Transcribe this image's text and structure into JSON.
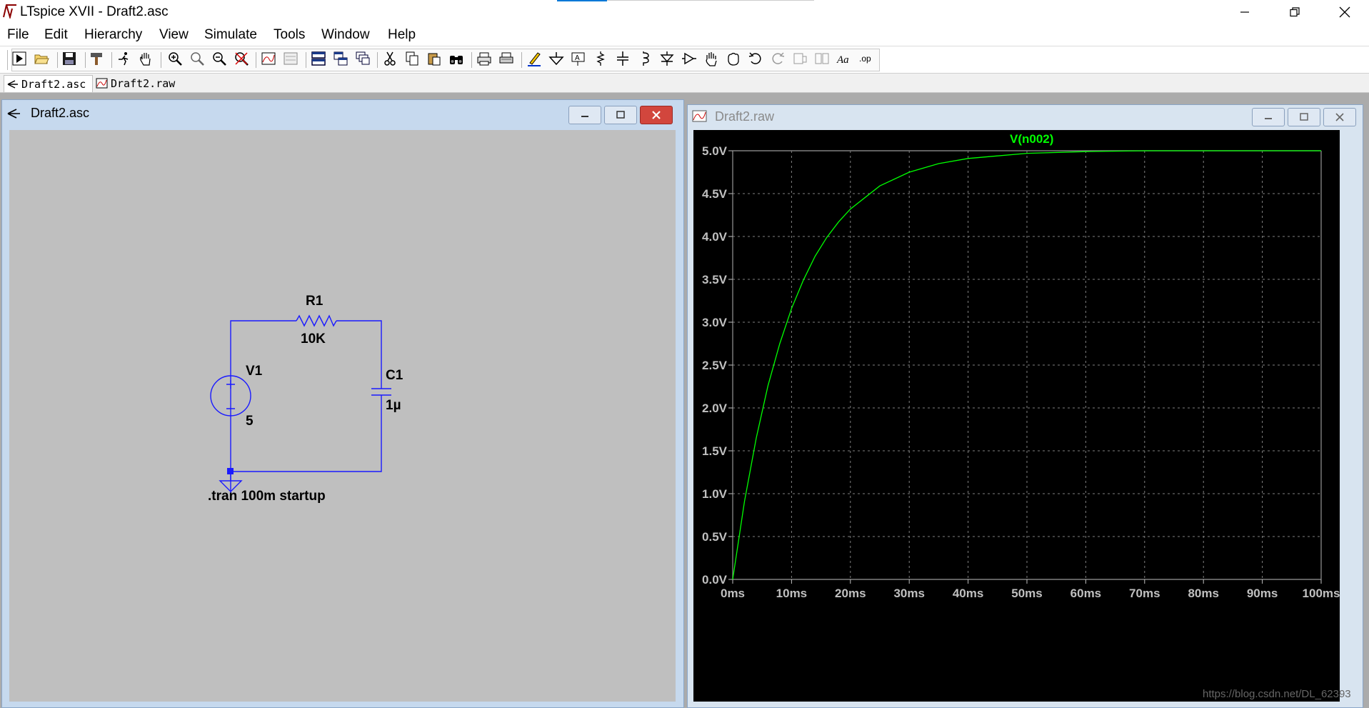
{
  "app": {
    "title": "LTspice XVII - Draft2.asc",
    "icon": "ltspice-logo-icon"
  },
  "window_controls": [
    "minimize-icon",
    "restore-icon",
    "close-icon"
  ],
  "menu": [
    "File",
    "Edit",
    "Hierarchy",
    "View",
    "Simulate",
    "Tools",
    "Window",
    "Help"
  ],
  "toolbar": {
    "buttons": [
      "run",
      "open",
      "save",
      "control-panel",
      "halt",
      "pan",
      "zoom-in",
      "zoom-area",
      "zoom-out",
      "zoom-fit",
      "autorange",
      "mark-unref",
      "tile-horizontal",
      "tile-vertical",
      "cascade",
      "cut",
      "copy",
      "paste",
      "find",
      "print-setup",
      "print",
      "draw-wire",
      "ground",
      "label-net",
      "resistor",
      "capacitor",
      "inductor",
      "diode",
      "component",
      "move",
      "drag",
      "undo",
      "redo",
      "rotate",
      "mirror",
      "text",
      "spice-directive"
    ]
  },
  "tabs": [
    {
      "label": "Draft2.asc",
      "icon": "schematic-icon",
      "active": true
    },
    {
      "label": "Draft2.raw",
      "icon": "waveform-icon",
      "active": false
    }
  ],
  "schematic_window": {
    "title": "Draft2.asc",
    "components": {
      "resistor": {
        "name": "R1",
        "value": "10K"
      },
      "source": {
        "name": "V1",
        "value": "5"
      },
      "capacitor": {
        "name": "C1",
        "value": "1µ"
      }
    },
    "directive": ".tran 100m startup"
  },
  "waveform_window": {
    "title": "Draft2.raw",
    "trace_label": "V(n002)",
    "watermark": "https://blog.csdn.net/DL_62393"
  },
  "colors": {
    "schematic_bg": "#bfbfbf",
    "wire": "#1a1aff",
    "plot_bg": "#000000",
    "trace": "#00ff00",
    "grid": "#808080",
    "axis_text": "#c0c0c0",
    "window_frame": "#c6d9ee",
    "close_button": "#d2463d"
  },
  "chart_data": {
    "type": "line",
    "title": "V(n002)",
    "xlabel": "",
    "ylabel": "",
    "xlim": [
      0,
      100
    ],
    "ylim": [
      0,
      5
    ],
    "x_tick_labels": [
      "0ms",
      "10ms",
      "20ms",
      "30ms",
      "40ms",
      "50ms",
      "60ms",
      "70ms",
      "80ms",
      "90ms",
      "100ms"
    ],
    "y_tick_labels": [
      "0.0V",
      "0.5V",
      "1.0V",
      "1.5V",
      "2.0V",
      "2.5V",
      "3.0V",
      "3.5V",
      "4.0V",
      "4.5V",
      "5.0V"
    ],
    "grid": true,
    "legend": "top-center",
    "series": [
      {
        "name": "V(n002)",
        "x": [
          0,
          2,
          4,
          6,
          8,
          10,
          12,
          14,
          16,
          18,
          20,
          25,
          30,
          35,
          40,
          45,
          50,
          60,
          70,
          80,
          90,
          100
        ],
        "values": [
          0,
          0.91,
          1.65,
          2.26,
          2.75,
          3.16,
          3.49,
          3.77,
          3.99,
          4.17,
          4.32,
          4.59,
          4.75,
          4.85,
          4.91,
          4.94,
          4.97,
          4.99,
          5.0,
          5.0,
          5.0,
          5.0
        ]
      }
    ]
  }
}
